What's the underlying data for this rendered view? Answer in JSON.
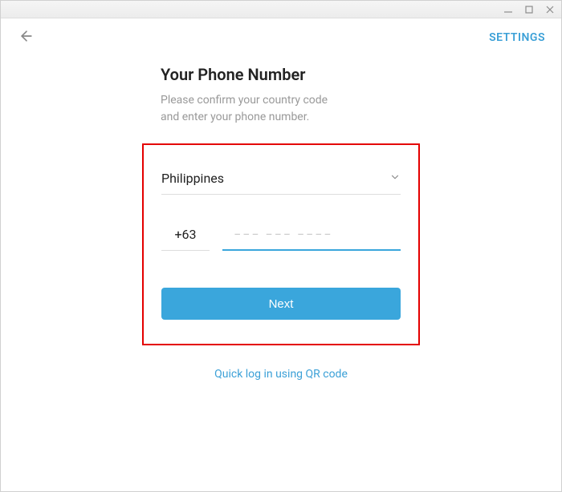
{
  "topbar": {
    "settings_label": "SETTINGS"
  },
  "heading": {
    "title": "Your Phone Number",
    "subtitle_line1": "Please confirm your country code",
    "subtitle_line2": "and enter your phone number."
  },
  "form": {
    "country": "Philippines",
    "dial_code": "+63",
    "phone_value": "",
    "phone_placeholder": "−−− −−− −−−−",
    "next_label": "Next"
  },
  "qr": {
    "label": "Quick log in using QR code"
  }
}
